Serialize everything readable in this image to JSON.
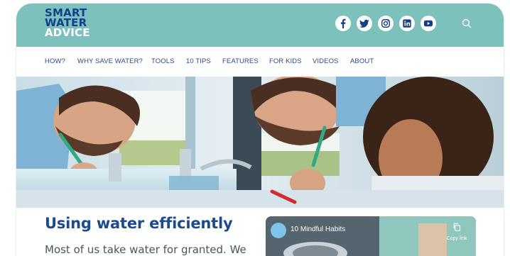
{
  "brand": {
    "logo_line1": "SMART",
    "logo_line2": "WATER",
    "logo_line3": "ADVICE",
    "color_primary": "#7cc1bb",
    "color_text": "#123f8a"
  },
  "social": [
    {
      "icon": "facebook-icon",
      "name": "Facebook"
    },
    {
      "icon": "twitter-icon",
      "name": "Twitter"
    },
    {
      "icon": "instagram-icon",
      "name": "Instagram"
    },
    {
      "icon": "linkedin-icon",
      "name": "LinkedIn"
    },
    {
      "icon": "youtube-icon",
      "name": "YouTube"
    }
  ],
  "search": {
    "icon": "search-icon"
  },
  "nav": {
    "items": [
      "HOW?",
      "WHY SAVE WATER?",
      "TOOLS",
      "10 TIPS",
      "FEATURES",
      "FOR KIDS",
      "VIDEOS",
      "ABOUT"
    ]
  },
  "main": {
    "heading": "Using water efficiently",
    "paragraph": "Most of us take water for granted. We"
  },
  "video": {
    "title": "10 Mindful Habits",
    "copy_label": "Copy link",
    "copy_icon": "copy-icon"
  }
}
